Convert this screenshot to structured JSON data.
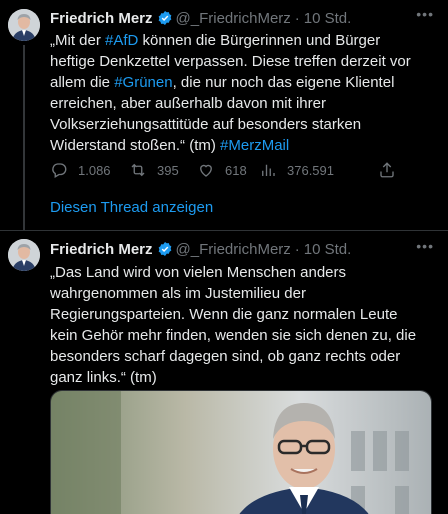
{
  "tweet1": {
    "name": "Friedrich Merz",
    "handle": "@_FriedrichMerz",
    "separator": "·",
    "time": "10 Std.",
    "text_lines": [
      [
        "„Mit der ",
        "#AfD",
        " können die Bürgerinnen und Bürger"
      ],
      [
        "heftige Denkzettel verpassen. Diese treffen derzeit vor"
      ],
      [
        "allem die ",
        "#Grünen",
        ", die nur noch das eigene Klientel"
      ],
      [
        "erreichen, aber außerhalb davon mit ihrer"
      ],
      [
        "Volkserziehungsattitüde auf besonders starken"
      ],
      [
        "Widerstand stoßen.“ (tm) ",
        "#MerzMail"
      ]
    ],
    "stats": {
      "replies": "1.086",
      "retweets": "395",
      "likes": "618",
      "views": "376.591"
    },
    "thread_link": "Diesen Thread anzeigen"
  },
  "tweet2": {
    "name": "Friedrich Merz",
    "handle": "@_FriedrichMerz",
    "separator": "·",
    "time": "10 Std.",
    "text_lines": [
      "„Das Land wird von vielen Menschen anders",
      "wahrgenommen als im Justemilieu der",
      "Regierungsparteien. Wenn die ganz normalen Leute",
      "kein Gehör mehr finden, wenden sie sich denen zu, die",
      "besonders scharf dagegen sind, ob ganz rechts oder",
      "ganz links.“ (tm)"
    ]
  },
  "colors": {
    "background": "#000000",
    "text": "#e7e9ea",
    "muted": "#71767b",
    "accent": "#1d9bf0",
    "border": "#2f3336"
  },
  "icons": {
    "verified": "verified-badge-icon",
    "reply": "reply-icon",
    "retweet": "retweet-icon",
    "like": "heart-icon",
    "views": "views-icon",
    "share": "share-icon",
    "more": "more-icon"
  }
}
